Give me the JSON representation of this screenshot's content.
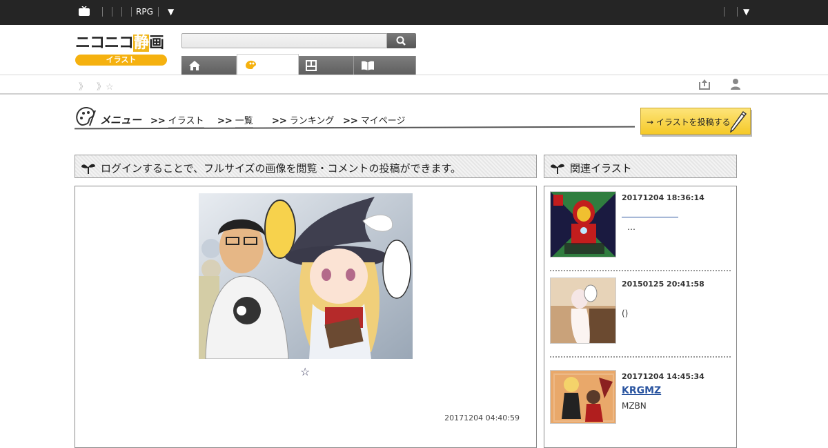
{
  "topbar": {
    "menu_label": "RPG",
    "dropdown_glyph": "▼",
    "tv_icon": "niconico-tv-icon"
  },
  "logo": {
    "text_a": "ニコニコ",
    "text_b": "静",
    "text_c": "画",
    "sub": "イラスト"
  },
  "search": {
    "placeholder": ""
  },
  "subnav": {
    "crumb1": "》",
    "crumb2": "》☆"
  },
  "menu": {
    "title": "メニュー",
    "arrow": ">>",
    "links": [
      "イラスト",
      "一覧",
      "ランキング",
      "マイページ"
    ],
    "post_button": "→ イラストを投稿する"
  },
  "main": {
    "notice": "ログインすることで、フルサイズの画像を閲覧・コメントの投稿ができます。",
    "star": "☆",
    "date": "20171204 04:40:59"
  },
  "side": {
    "title": "関連イラスト",
    "items": [
      {
        "date": "20171204 18:36:14",
        "title": "",
        "desc": "…"
      },
      {
        "date": "20150125 20:41:58",
        "title": "",
        "desc": "()"
      },
      {
        "date": "20171204 14:45:34",
        "title": "KRGMZ",
        "desc": "MZBN"
      }
    ]
  },
  "colors": {
    "topbar": "#252525",
    "accent": "#f5b10f",
    "link": "#2b55a0"
  }
}
